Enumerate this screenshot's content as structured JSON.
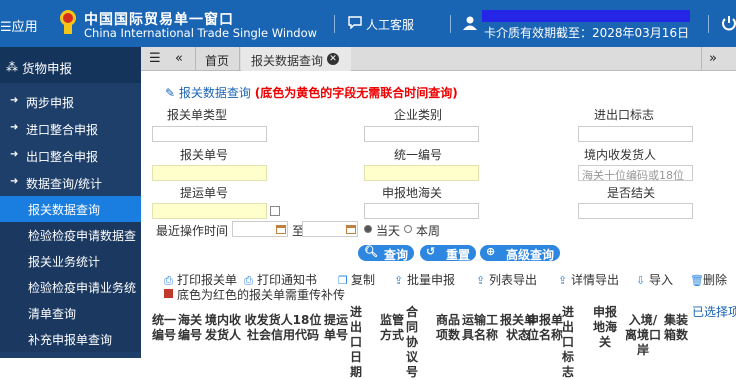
{
  "header": {
    "apps_label": "应用",
    "title_cn": "中国国际贸易单一窗口",
    "title_en": "China International Trade Single Window",
    "service_label": "人工客服",
    "cert_info": "卡介质有效期截至：2028年03月16日"
  },
  "sidebar": {
    "title": "货物申报",
    "items": [
      {
        "label": "两步申报"
      },
      {
        "label": "进口整合申报"
      },
      {
        "label": "出口整合申报"
      },
      {
        "label": "数据查询/统计"
      }
    ],
    "subitems": [
      {
        "label": "报关数据查询"
      },
      {
        "label": "检验检疫申请数据查"
      },
      {
        "label": "报关业务统计"
      },
      {
        "label": "检验检疫申请业务统"
      },
      {
        "label": "清单查询"
      },
      {
        "label": "补充申报单查询"
      }
    ]
  },
  "tabbar": {
    "home": "首页",
    "active_tab": "报关数据查询"
  },
  "form": {
    "title": "报关数据查询",
    "note": "(底色为黄色的字段无需联合时间查询)",
    "labels": {
      "decl_type": "报关单类型",
      "enterprise_type": "企业类别",
      "ie_flag": "进出口标志",
      "entry_no": "报关单号",
      "unified_no": "统一编号",
      "consignee": "境内收发货人",
      "bl_no": "提运单号",
      "decl_port": "申报地海关",
      "closed": "是否结关",
      "last_op_time": "最近操作时间",
      "to": "至",
      "today": "当天",
      "this_week": "本周"
    },
    "consignee_placeholder": "海关十位编码或18位",
    "buttons": {
      "query": "查询",
      "reset": "重置",
      "advanced": "高级查询"
    }
  },
  "toolbar": {
    "items": [
      {
        "label": "打印报关单"
      },
      {
        "label": "打印通知书"
      },
      {
        "label": "复制"
      },
      {
        "label": "批量申报"
      },
      {
        "label": "列表导出"
      },
      {
        "label": "详情导出"
      },
      {
        "label": "导入"
      },
      {
        "label": "删除"
      }
    ],
    "red_note": "底色为红色的报关单需重传补传"
  },
  "table": {
    "headers": [
      "统一编号",
      "海关编号",
      "境内收发货人",
      "收发货人18位社会信用代码",
      "提运单号",
      "进出口日期",
      "监管方式",
      "合同协议号",
      "商品项数",
      "运输工具名称",
      "报关单状态",
      "申报单位名称",
      "进出口标志",
      "申报地海关",
      "入境/离境口岸",
      "集装箱数"
    ],
    "selected_label": "已选择项"
  },
  "colors": {
    "header_bg": "#1a64b4",
    "sidebar_bg": "#1e3f6a",
    "active_item": "#1a7ee0",
    "required_yellow": "#ffffcc",
    "note_red": "#ee0000"
  }
}
